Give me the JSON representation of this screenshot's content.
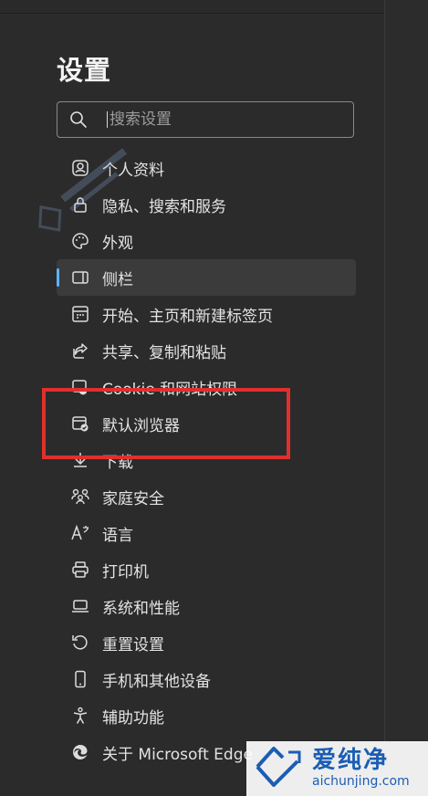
{
  "page": {
    "title": "设置"
  },
  "search": {
    "placeholder": "搜索设置"
  },
  "menu": {
    "items": [
      {
        "label": "个人资料",
        "icon": "profile-icon",
        "active": false
      },
      {
        "label": "隐私、搜索和服务",
        "icon": "lock-icon",
        "active": false
      },
      {
        "label": "外观",
        "icon": "palette-icon",
        "active": false
      },
      {
        "label": "侧栏",
        "icon": "sidebar-icon",
        "active": true
      },
      {
        "label": "开始、主页和新建标签页",
        "icon": "home-grid-icon",
        "active": false
      },
      {
        "label": "共享、复制和粘贴",
        "icon": "share-icon",
        "active": false
      },
      {
        "label": "Cookie 和网站权限",
        "icon": "cookie-shield-icon",
        "active": false
      },
      {
        "label": "默认浏览器",
        "icon": "default-browser-icon",
        "active": false
      },
      {
        "label": "下载",
        "icon": "download-icon",
        "active": false
      },
      {
        "label": "家庭安全",
        "icon": "family-icon",
        "active": false
      },
      {
        "label": "语言",
        "icon": "language-icon",
        "active": false
      },
      {
        "label": "打印机",
        "icon": "printer-icon",
        "active": false
      },
      {
        "label": "系统和性能",
        "icon": "laptop-icon",
        "active": false
      },
      {
        "label": "重置设置",
        "icon": "reset-icon",
        "active": false
      },
      {
        "label": "手机和其他设备",
        "icon": "phone-icon",
        "active": false
      },
      {
        "label": "辅助功能",
        "icon": "accessibility-icon",
        "active": false
      },
      {
        "label": "关于 Microsoft Edge",
        "icon": "edge-logo-icon",
        "active": false
      }
    ]
  },
  "watermark": {
    "brand_cn": "爱纯净",
    "brand_en": "aichunjing.com"
  },
  "colors": {
    "background": "#2b2b2b",
    "accent": "#5fb2ff",
    "highlight": "#e0302c"
  }
}
